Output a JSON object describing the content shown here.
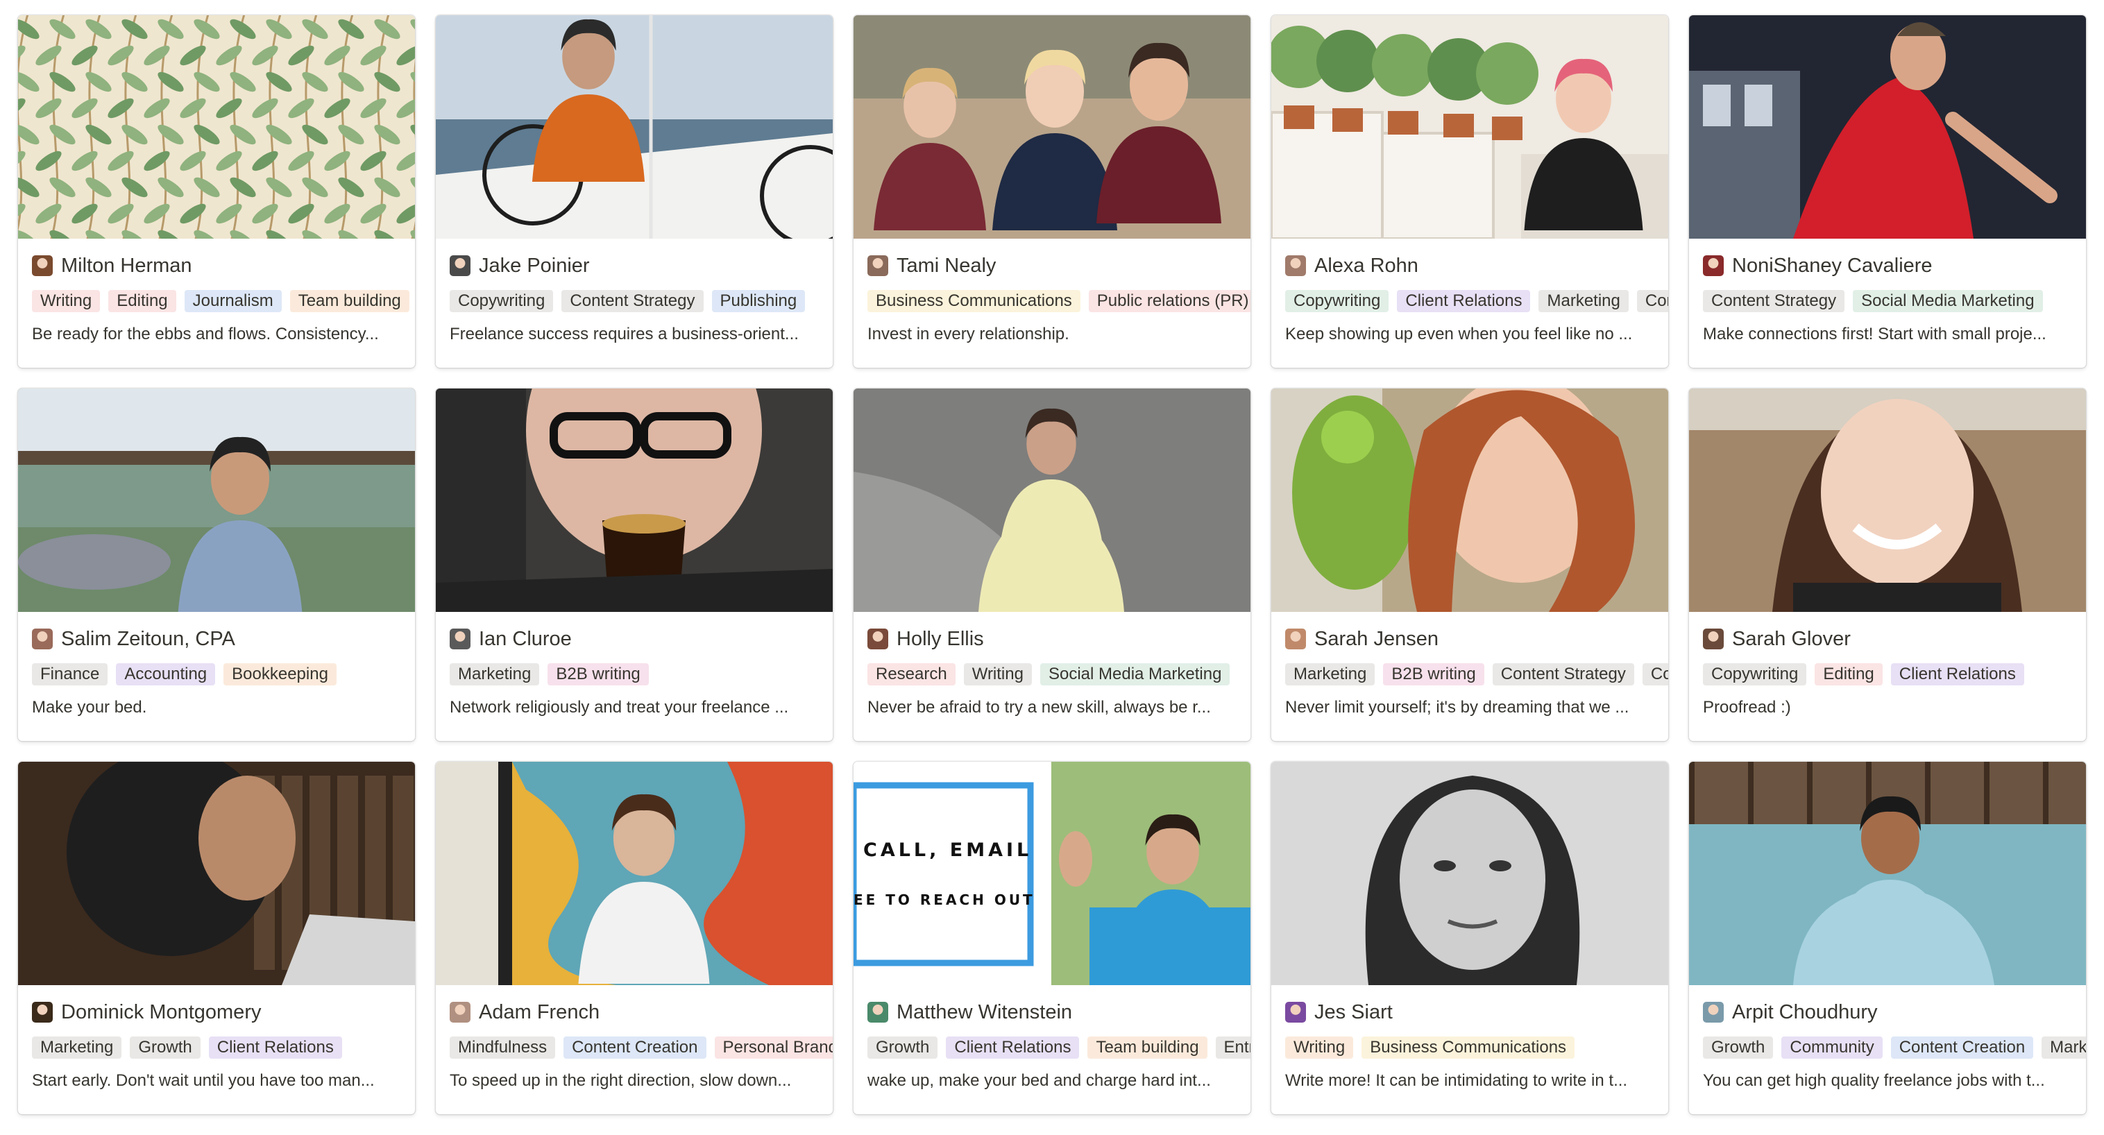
{
  "tag_colors": {
    "red": "#fbe4e4",
    "blue": "#dde7f7",
    "gray": "#e9e8e6",
    "orange": "#fbeadb",
    "purple": "#e8e0f5",
    "yellow": "#fbf3db",
    "pink": "#f7e1ec",
    "green": "#e1efe7"
  },
  "cards": [
    {
      "name": "Milton Herman",
      "avatar_color": "#7a4a2e",
      "cover": "leaves",
      "tags": [
        {
          "label": "Writing",
          "color": "red"
        },
        {
          "label": "Editing",
          "color": "red"
        },
        {
          "label": "Journalism",
          "color": "blue"
        },
        {
          "label": "Team building",
          "color": "orange"
        }
      ],
      "quote": "Be ready for the ebbs and flows. Consistency..."
    },
    {
      "name": "Jake Poinier",
      "avatar_color": "#4a4a4a",
      "cover": "boat",
      "tags": [
        {
          "label": "Copywriting",
          "color": "gray"
        },
        {
          "label": "Content Strategy",
          "color": "gray"
        },
        {
          "label": "Publishing",
          "color": "blue"
        }
      ],
      "quote": "Freelance success requires a business-orient..."
    },
    {
      "name": "Tami Nealy",
      "avatar_color": "#8a6a5a",
      "cover": "family",
      "tags": [
        {
          "label": "Business Communications",
          "color": "yellow"
        },
        {
          "label": "Public relations (PR)",
          "color": "red"
        }
      ],
      "quote": "Invest in every relationship."
    },
    {
      "name": "Alexa Rohn",
      "avatar_color": "#a07a6a",
      "cover": "plants",
      "tags": [
        {
          "label": "Copywriting",
          "color": "green"
        },
        {
          "label": "Client Relations",
          "color": "purple"
        },
        {
          "label": "Marketing",
          "color": "gray"
        },
        {
          "label": "Content",
          "color": "gray"
        }
      ],
      "quote": "Keep showing up even when you feel like no ..."
    },
    {
      "name": "NoniShaney Cavaliere",
      "avatar_color": "#8a2a2a",
      "cover": "stage",
      "tags": [
        {
          "label": "Content Strategy",
          "color": "gray"
        },
        {
          "label": "Social Media Marketing",
          "color": "green"
        }
      ],
      "quote": "Make connections first! Start with small proje..."
    },
    {
      "name": "Salim Zeitoun, CPA",
      "avatar_color": "#9a6a5a",
      "cover": "garden",
      "tags": [
        {
          "label": "Finance",
          "color": "gray"
        },
        {
          "label": "Accounting",
          "color": "purple"
        },
        {
          "label": "Bookkeeping",
          "color": "orange"
        }
      ],
      "quote": "Make your bed."
    },
    {
      "name": "Ian Cluroe",
      "avatar_color": "#5a5a5a",
      "cover": "coffee",
      "tags": [
        {
          "label": "Marketing",
          "color": "gray"
        },
        {
          "label": "B2B writing",
          "color": "pink"
        }
      ],
      "quote": "Network religiously and treat your freelance ..."
    },
    {
      "name": "Holly Ellis",
      "avatar_color": "#7a4a3a",
      "cover": "rock",
      "tags": [
        {
          "label": "Research",
          "color": "red"
        },
        {
          "label": "Writing",
          "color": "gray"
        },
        {
          "label": "Social Media Marketing",
          "color": "green"
        }
      ],
      "quote": "Never be afraid to try a new skill, always be r..."
    },
    {
      "name": "Sarah Jensen",
      "avatar_color": "#c08a6a",
      "cover": "parrot",
      "tags": [
        {
          "label": "Marketing",
          "color": "gray"
        },
        {
          "label": "B2B writing",
          "color": "pink"
        },
        {
          "label": "Content Strategy",
          "color": "gray"
        },
        {
          "label": "Copy",
          "color": "gray"
        }
      ],
      "quote": "Never limit yourself; it's by dreaming that we ..."
    },
    {
      "name": "Sarah Glover",
      "avatar_color": "#6a4a3a",
      "cover": "smile",
      "tags": [
        {
          "label": "Copywriting",
          "color": "gray"
        },
        {
          "label": "Editing",
          "color": "red"
        },
        {
          "label": "Client Relations",
          "color": "purple"
        }
      ],
      "quote": "Proofread :)"
    },
    {
      "name": "Dominick Montgomery",
      "avatar_color": "#3a2a1a",
      "cover": "laptop",
      "tags": [
        {
          "label": "Marketing",
          "color": "gray"
        },
        {
          "label": "Growth",
          "color": "gray"
        },
        {
          "label": "Client Relations",
          "color": "purple"
        }
      ],
      "quote": "Start early. Don't wait until you have too man..."
    },
    {
      "name": "Adam French",
      "avatar_color": "#b09080",
      "cover": "art",
      "tags": [
        {
          "label": "Mindfulness",
          "color": "gray"
        },
        {
          "label": "Content Creation",
          "color": "blue"
        },
        {
          "label": "Personal Branding",
          "color": "red"
        }
      ],
      "quote": "To speed up in the right direction, slow down..."
    },
    {
      "name": "Matthew Witenstein",
      "avatar_color": "#4a8a6a",
      "cover": "wave",
      "cover_text": [
        "CALL, EMAIL",
        "EE TO REACH OUT"
      ],
      "tags": [
        {
          "label": "Growth",
          "color": "gray"
        },
        {
          "label": "Client Relations",
          "color": "purple"
        },
        {
          "label": "Team building",
          "color": "orange"
        },
        {
          "label": "Entrepreneurship",
          "color": "gray"
        }
      ],
      "quote": "wake up, make your bed and charge hard int..."
    },
    {
      "name": "Jes Siart",
      "avatar_color": "#7a4aa0",
      "cover": "bw",
      "tags": [
        {
          "label": "Writing",
          "color": "orange"
        },
        {
          "label": "Business Communications",
          "color": "yellow"
        }
      ],
      "quote": "Write more! It can be intimidating to write in t..."
    },
    {
      "name": "Arpit Choudhury",
      "avatar_color": "#7a9aaa",
      "cover": "cafe",
      "tags": [
        {
          "label": "Growth",
          "color": "gray"
        },
        {
          "label": "Community",
          "color": "purple"
        },
        {
          "label": "Content Creation",
          "color": "blue"
        },
        {
          "label": "Marketing",
          "color": "gray"
        }
      ],
      "quote": "You can get high quality freelance jobs with t..."
    }
  ]
}
